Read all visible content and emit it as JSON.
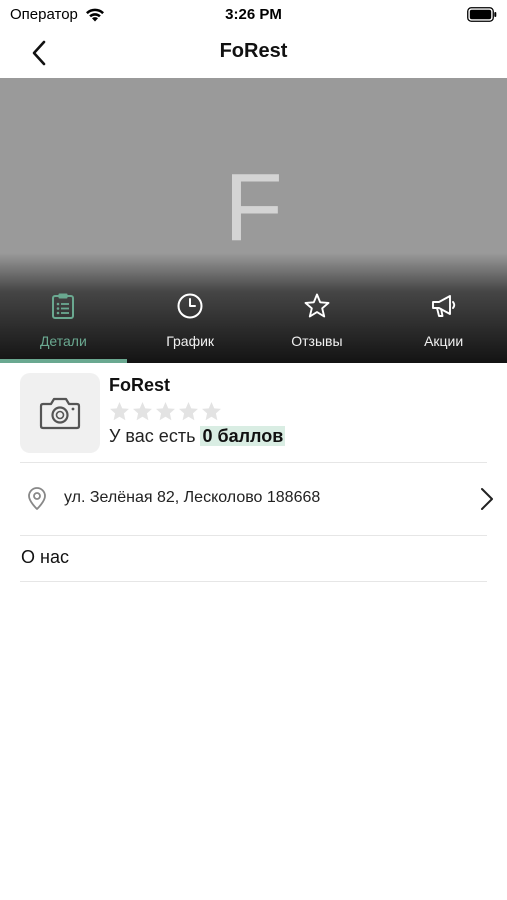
{
  "status_bar": {
    "carrier": "Оператор",
    "time": "3:26 PM"
  },
  "nav": {
    "title": "FoRest",
    "back_icon": "chevron-left-icon"
  },
  "hero": {
    "placeholder_letter": "F",
    "background_color": "#9a9a9a"
  },
  "tabs": [
    {
      "label": "Детали",
      "icon": "clipboard-list-icon",
      "active": true
    },
    {
      "label": "График",
      "icon": "clock-icon",
      "active": false
    },
    {
      "label": "Отзывы",
      "icon": "star-outline-icon",
      "active": false
    },
    {
      "label": "Акции",
      "icon": "megaphone-icon",
      "active": false
    }
  ],
  "venue": {
    "name": "FoRest",
    "rating": 0,
    "rating_max": 5,
    "points_prefix": "У вас есть",
    "points_value": "0 баллов"
  },
  "address": {
    "text": "ул. Зелёная 82, Лесколово 188668"
  },
  "about": {
    "label": "О нас"
  },
  "colors": {
    "accent": "#6aa890",
    "points_highlight": "#d9ede3",
    "star_empty": "#e3e3e3"
  }
}
